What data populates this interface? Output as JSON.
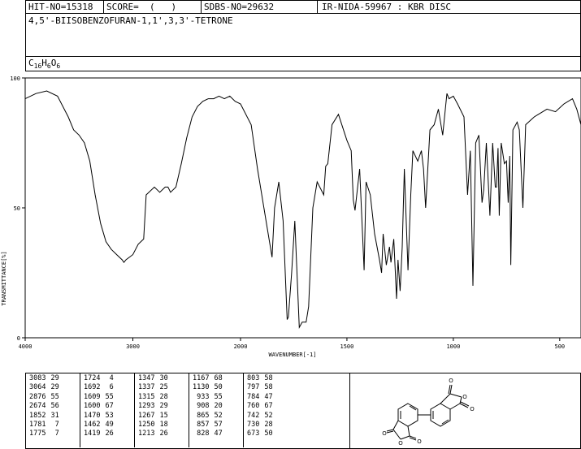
{
  "header": {
    "hit_no": "HIT-NO=15318",
    "score": "SCORE=  (   )",
    "sdbs_no": "SDBS-NO=29632",
    "ir_info": "IR-NIDA-59967 : KBR DISC",
    "compound_name": "4,5'-BIISOBENZOFURAN-1,1',3,3'-TETRONE",
    "formula_c": "C",
    "formula_c_sub": "16",
    "formula_h": "H",
    "formula_h_sub": "6",
    "formula_o": "O",
    "formula_o_sub": "6"
  },
  "chart_data": {
    "type": "line",
    "title": "",
    "xlabel": "WAVENUMBER[-1]",
    "ylabel": "TRANSMITTANCE[%]",
    "xlim": [
      4000,
      400
    ],
    "ylim": [
      0,
      100
    ],
    "x_ticks": [
      4000,
      3000,
      2000,
      1500,
      1000,
      500
    ],
    "y_ticks": [
      0,
      50,
      100
    ],
    "series": [
      {
        "points": [
          [
            4000,
            92
          ],
          [
            3900,
            94
          ],
          [
            3800,
            95
          ],
          [
            3700,
            93
          ],
          [
            3600,
            85
          ],
          [
            3550,
            80
          ],
          [
            3500,
            78
          ],
          [
            3450,
            75
          ],
          [
            3400,
            68
          ],
          [
            3350,
            55
          ],
          [
            3300,
            44
          ],
          [
            3250,
            37
          ],
          [
            3200,
            34
          ],
          [
            3150,
            32
          ],
          [
            3100,
            30
          ],
          [
            3083,
            29
          ],
          [
            3064,
            30
          ],
          [
            3000,
            32
          ],
          [
            2950,
            36
          ],
          [
            2900,
            38
          ],
          [
            2876,
            55
          ],
          [
            2800,
            58
          ],
          [
            2750,
            56
          ],
          [
            2700,
            58
          ],
          [
            2674,
            58
          ],
          [
            2650,
            56
          ],
          [
            2600,
            58
          ],
          [
            2550,
            67
          ],
          [
            2500,
            77
          ],
          [
            2450,
            85
          ],
          [
            2400,
            89
          ],
          [
            2350,
            91
          ],
          [
            2300,
            92
          ],
          [
            2250,
            92
          ],
          [
            2200,
            93
          ],
          [
            2150,
            92
          ],
          [
            2100,
            93
          ],
          [
            2050,
            91
          ],
          [
            2000,
            90
          ],
          [
            1950,
            82
          ],
          [
            1920,
            65
          ],
          [
            1880,
            45
          ],
          [
            1852,
            31
          ],
          [
            1840,
            50
          ],
          [
            1820,
            60
          ],
          [
            1800,
            45
          ],
          [
            1781,
            7
          ],
          [
            1775,
            8
          ],
          [
            1760,
            25
          ],
          [
            1745,
            45
          ],
          [
            1724,
            4
          ],
          [
            1710,
            6
          ],
          [
            1692,
            6
          ],
          [
            1680,
            12
          ],
          [
            1660,
            50
          ],
          [
            1640,
            60
          ],
          [
            1609,
            55
          ],
          [
            1600,
            66
          ],
          [
            1590,
            67
          ],
          [
            1570,
            82
          ],
          [
            1540,
            86
          ],
          [
            1520,
            81
          ],
          [
            1500,
            76
          ],
          [
            1480,
            72
          ],
          [
            1470,
            53
          ],
          [
            1462,
            49
          ],
          [
            1440,
            65
          ],
          [
            1419,
            26
          ],
          [
            1410,
            60
          ],
          [
            1390,
            55
          ],
          [
            1370,
            40
          ],
          [
            1347,
            30
          ],
          [
            1337,
            25
          ],
          [
            1330,
            40
          ],
          [
            1315,
            28
          ],
          [
            1300,
            35
          ],
          [
            1293,
            29
          ],
          [
            1280,
            38
          ],
          [
            1267,
            15
          ],
          [
            1260,
            30
          ],
          [
            1250,
            18
          ],
          [
            1240,
            35
          ],
          [
            1230,
            65
          ],
          [
            1213,
            26
          ],
          [
            1200,
            55
          ],
          [
            1190,
            72
          ],
          [
            1167,
            68
          ],
          [
            1150,
            72
          ],
          [
            1140,
            65
          ],
          [
            1130,
            50
          ],
          [
            1110,
            80
          ],
          [
            1090,
            82
          ],
          [
            1070,
            88
          ],
          [
            1050,
            78
          ],
          [
            1030,
            94
          ],
          [
            1020,
            92
          ],
          [
            1000,
            93
          ],
          [
            980,
            90
          ],
          [
            950,
            85
          ],
          [
            933,
            55
          ],
          [
            920,
            72
          ],
          [
            908,
            20
          ],
          [
            895,
            75
          ],
          [
            880,
            78
          ],
          [
            865,
            52
          ],
          [
            857,
            57
          ],
          [
            845,
            75
          ],
          [
            828,
            47
          ],
          [
            815,
            75
          ],
          [
            803,
            58
          ],
          [
            797,
            58
          ],
          [
            790,
            73
          ],
          [
            784,
            47
          ],
          [
            775,
            75
          ],
          [
            760,
            67
          ],
          [
            750,
            68
          ],
          [
            742,
            52
          ],
          [
            735,
            70
          ],
          [
            730,
            28
          ],
          [
            720,
            80
          ],
          [
            700,
            83
          ],
          [
            690,
            80
          ],
          [
            673,
            50
          ],
          [
            660,
            82
          ],
          [
            620,
            85
          ],
          [
            600,
            86
          ],
          [
            560,
            88
          ],
          [
            520,
            87
          ],
          [
            480,
            90
          ],
          [
            440,
            92
          ],
          [
            420,
            88
          ],
          [
            400,
            82
          ]
        ]
      }
    ]
  },
  "peaks": {
    "col1": [
      [
        "3083",
        "29"
      ],
      [
        "3064",
        "29"
      ],
      [
        "2876",
        "55"
      ],
      [
        "2674",
        "56"
      ],
      [
        "1852",
        "31"
      ],
      [
        "1781",
        "7"
      ],
      [
        "1775",
        "7"
      ]
    ],
    "col2": [
      [
        "1724",
        "4"
      ],
      [
        "1692",
        "6"
      ],
      [
        "1609",
        "55"
      ],
      [
        "1600",
        "67"
      ],
      [
        "1470",
        "53"
      ],
      [
        "1462",
        "49"
      ],
      [
        "1419",
        "26"
      ]
    ],
    "col3": [
      [
        "1347",
        "30"
      ],
      [
        "1337",
        "25"
      ],
      [
        "1315",
        "28"
      ],
      [
        "1293",
        "29"
      ],
      [
        "1267",
        "15"
      ],
      [
        "1250",
        "18"
      ],
      [
        "1213",
        "26"
      ]
    ],
    "col4": [
      [
        "1167",
        "68"
      ],
      [
        "1130",
        "50"
      ],
      [
        "933",
        "55"
      ],
      [
        "908",
        "20"
      ],
      [
        "865",
        "52"
      ],
      [
        "857",
        "57"
      ],
      [
        "828",
        "47"
      ]
    ],
    "col5": [
      [
        "803",
        "58"
      ],
      [
        "797",
        "58"
      ],
      [
        "784",
        "47"
      ],
      [
        "760",
        "67"
      ],
      [
        "742",
        "52"
      ],
      [
        "730",
        "28"
      ],
      [
        "673",
        "50"
      ]
    ]
  },
  "structure": {
    "atom_labels": [
      "O",
      "O",
      "O",
      "O",
      "O",
      "O"
    ]
  }
}
